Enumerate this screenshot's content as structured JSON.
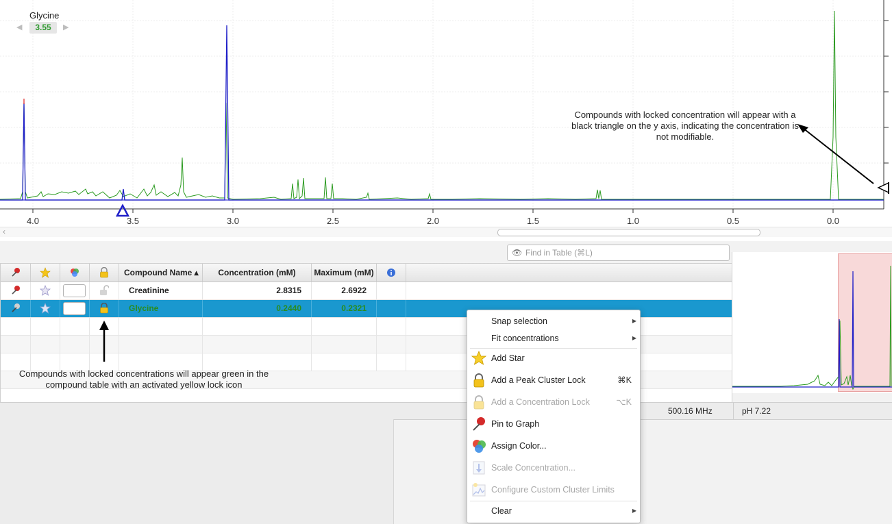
{
  "spectrum": {
    "compound_label": "Glycine",
    "compound_value": "3.55",
    "x_ticks": [
      "4.0",
      "3.5",
      "3.0",
      "2.5",
      "2.0",
      "1.5",
      "1.0",
      "0.5",
      "0.0"
    ],
    "annotation": "Compounds with locked concentration will appear with a black triangle on the y axis, indicating the concentration is not modifiable."
  },
  "find": {
    "placeholder": "Find in Table (⌘L)"
  },
  "table": {
    "headers": [
      "Compound Name ▴",
      "Concentration (mM)",
      "Maximum (mM)"
    ],
    "rows": [
      {
        "name": "Creatinine",
        "concentration": "2.8315",
        "maximum": "2.6922"
      },
      {
        "name": "Glycine",
        "concentration": "0.2440",
        "maximum": "0.2321"
      }
    ]
  },
  "annotation_table": "Compounds with locked concentrations will appear green in the compound table with an activated yellow lock icon",
  "status": {
    "frequency": "500.16 MHz",
    "ph": "pH 7.22"
  },
  "menu": {
    "items": [
      {
        "label": "Snap selection",
        "shortcut": ""
      },
      {
        "label": "Fit concentrations",
        "shortcut": ""
      },
      {
        "label": "Add Star",
        "shortcut": ""
      },
      {
        "label": "Add a Peak Cluster Lock",
        "shortcut": "⌘K"
      },
      {
        "label": "Add a Concentration Lock",
        "shortcut": "⌥K"
      },
      {
        "label": "Pin to Graph",
        "shortcut": ""
      },
      {
        "label": "Assign Color...",
        "shortcut": ""
      },
      {
        "label": "Scale Concentration...",
        "shortcut": ""
      },
      {
        "label": "Configure Custom Cluster Limits",
        "shortcut": ""
      },
      {
        "label": "Clear",
        "shortcut": ""
      }
    ]
  },
  "colors": {
    "selection": "#1a98cf",
    "green": "#2a8c1f",
    "blue": "#1f1fc8"
  }
}
